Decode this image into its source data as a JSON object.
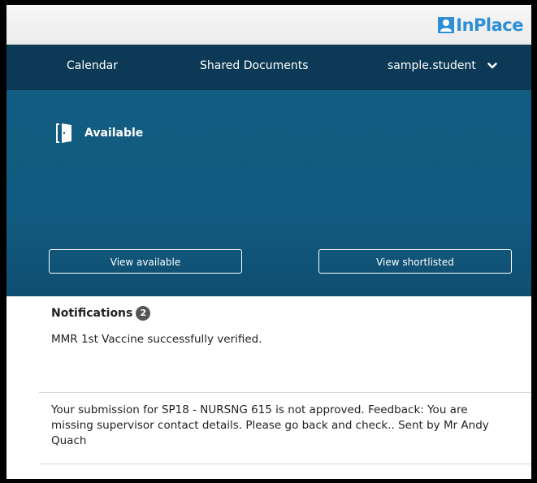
{
  "header": {
    "logo_text": "InPlace",
    "brand_color": "#2d8fd6"
  },
  "nav": {
    "calendar": "Calendar",
    "shared_documents": "Shared Documents",
    "user": "sample.student"
  },
  "hero": {
    "title": "Available",
    "view_available": "View available",
    "view_shortlisted": "View shortlisted",
    "background_color": "#135c81"
  },
  "notifications": {
    "title": "Notifications",
    "count": "2",
    "items": [
      {
        "text": "MMR 1st Vaccine successfully verified."
      },
      {
        "text": "Your submission for SP18 - NURSNG 615 is not approved. Feedback: You are missing supervisor contact details. Please go back and check.. Sent by Mr Andy Quach"
      }
    ]
  }
}
